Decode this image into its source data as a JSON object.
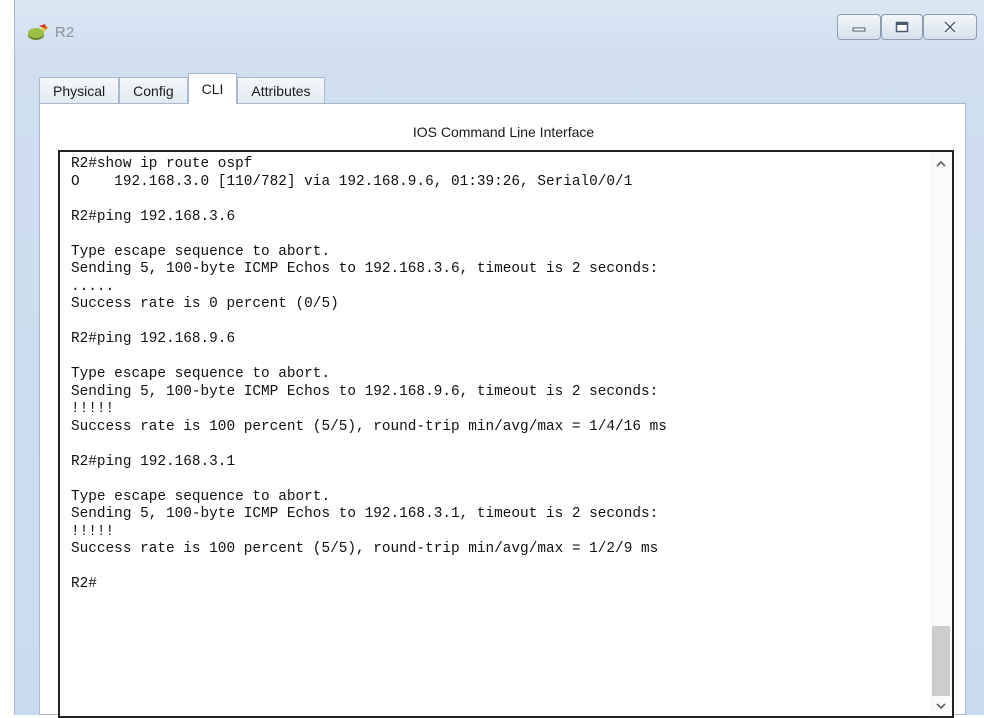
{
  "window": {
    "title": "R2"
  },
  "tabs": [
    {
      "label": "Physical",
      "active": false
    },
    {
      "label": "Config",
      "active": false
    },
    {
      "label": "CLI",
      "active": true
    },
    {
      "label": "Attributes",
      "active": false
    }
  ],
  "cli": {
    "header": "IOS Command Line Interface",
    "lines": [
      "R2#show ip route ospf",
      "O    192.168.3.0 [110/782] via 192.168.9.6, 01:39:26, Serial0/0/1",
      "",
      "R2#ping 192.168.3.6",
      "",
      "Type escape sequence to abort.",
      "Sending 5, 100-byte ICMP Echos to 192.168.3.6, timeout is 2 seconds:",
      ".....",
      "Success rate is 0 percent (0/5)",
      "",
      "R2#ping 192.168.9.6",
      "",
      "Type escape sequence to abort.",
      "Sending 5, 100-byte ICMP Echos to 192.168.9.6, timeout is 2 seconds:",
      "!!!!!",
      "Success rate is 100 percent (5/5), round-trip min/avg/max = 1/4/16 ms",
      "",
      "R2#ping 192.168.3.1",
      "",
      "Type escape sequence to abort.",
      "Sending 5, 100-byte ICMP Echos to 192.168.3.1, timeout is 2 seconds:",
      "!!!!!",
      "Success rate is 100 percent (5/5), round-trip min/avg/max = 1/2/9 ms",
      "",
      "R2#"
    ]
  },
  "icons": {
    "app": "router-icon",
    "minimize": "minimize-icon",
    "maximize": "maximize-icon",
    "close": "close-icon",
    "scroll_up": "chevron-up-icon",
    "scroll_down": "chevron-down-icon"
  },
  "colors": {
    "titlebar_bg": "#cfdff0",
    "console_border": "#222222",
    "scroll_thumb": "#cdcdcd"
  }
}
